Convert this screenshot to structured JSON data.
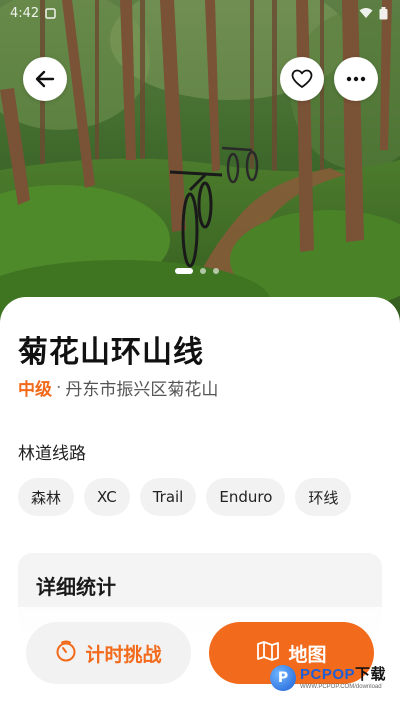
{
  "status_bar": {
    "time": "4:42",
    "icons": [
      "notification-icon",
      "wifi-icon",
      "battery-icon"
    ]
  },
  "hero": {
    "image": "forest-trail-with-mountain-bikes",
    "slides_count": 3,
    "active_slide": 1,
    "buttons": {
      "back": "back-arrow-icon",
      "favorite": "heart-icon",
      "more": "more-dots-icon"
    }
  },
  "route": {
    "title": "菊花山环山线",
    "level": "中级",
    "separator": "·",
    "location": "丹东市振兴区菊花山"
  },
  "trail_type": {
    "label": "林道线路",
    "tags": [
      "森林",
      "XC",
      "Trail",
      "Enduro",
      "环线"
    ]
  },
  "stats": {
    "title": "详细统计"
  },
  "actions": {
    "timer_challenge": "计时挑战",
    "map": "地图"
  },
  "watermark": {
    "logo_letter": "P",
    "brand": "PCPOP",
    "brand_suffix": "下载",
    "tagline": "WWW.PCPOP.COM/download"
  },
  "colors": {
    "accent": "#f26a1b",
    "chip_bg": "#f2f2f2",
    "card_bg": "#f4f4f4"
  }
}
